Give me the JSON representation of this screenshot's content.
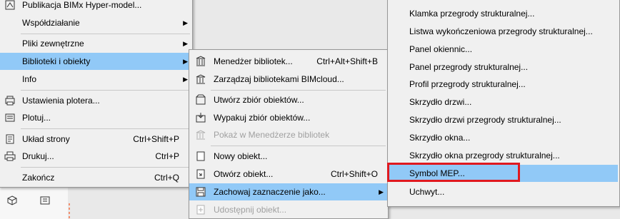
{
  "file_menu": {
    "items": [
      {
        "label": "Publikacja BIMx Hyper-model..."
      },
      {
        "label": "Współdziałanie",
        "arrow": "▶"
      },
      {
        "label": "Pliki zewnętrzne",
        "arrow": "▶"
      },
      {
        "label": "Biblioteki i obiekty",
        "arrow": "▶"
      },
      {
        "label": "Info",
        "arrow": "▶"
      },
      {
        "label": "Ustawienia plotera..."
      },
      {
        "label": "Plotuj..."
      },
      {
        "label": "Układ strony",
        "shortcut": "Ctrl+Shift+P"
      },
      {
        "label": "Drukuj...",
        "shortcut": "Ctrl+P"
      },
      {
        "label": "Zakończ",
        "shortcut": "Ctrl+Q"
      }
    ]
  },
  "libraries_menu": {
    "items": [
      {
        "label": "Menedżer bibliotek...",
        "shortcut": "Ctrl+Alt+Shift+B"
      },
      {
        "label": "Zarządzaj bibliotekami BIMcloud..."
      },
      {
        "label": "Utwórz zbiór obiektów..."
      },
      {
        "label": "Wypakuj zbiór obiektów..."
      },
      {
        "label": "Pokaż w Menedżerze bibliotek"
      },
      {
        "label": "Nowy obiekt..."
      },
      {
        "label": "Otwórz obiekt...",
        "shortcut": "Ctrl+Shift+O"
      },
      {
        "label": "Zachowaj zaznaczenie jako...",
        "arrow": "▶"
      },
      {
        "label": "Udostępnij obiekt..."
      }
    ]
  },
  "save_as_menu": {
    "items": [
      {
        "label": "Klamka przegrody strukturalnej..."
      },
      {
        "label": "Listwa wykończeniowa przegrody strukturalnej..."
      },
      {
        "label": "Panel okiennic..."
      },
      {
        "label": "Panel przegrody strukturalnej..."
      },
      {
        "label": "Profil przegrody strukturalnej..."
      },
      {
        "label": "Skrzydło drzwi..."
      },
      {
        "label": "Skrzydło drzwi przegrody strukturalnej..."
      },
      {
        "label": "Skrzydło okna..."
      },
      {
        "label": "Skrzydło okna przegrody strukturalnej..."
      },
      {
        "label": "Symbol MEP..."
      },
      {
        "label": "Uchwyt..."
      }
    ]
  },
  "colors": {
    "highlight": "#91c9f7",
    "menu_bg": "#f0f0f0",
    "annotation_box": "#e0191f",
    "disabled_text": "#a0a0a0"
  }
}
